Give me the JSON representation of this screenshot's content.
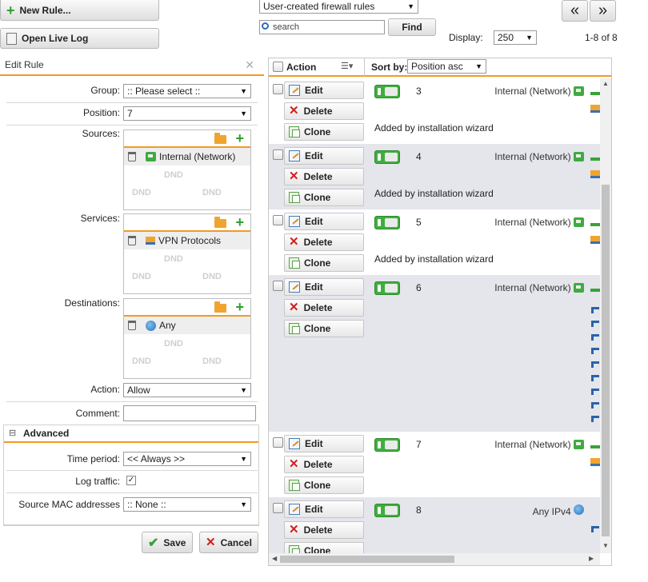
{
  "toolbar": {
    "new_rule": "New Rule...",
    "open_live_log": "Open Live Log",
    "filter_select": "User-created firewall rules",
    "search_placeholder": "search",
    "find": "Find",
    "display_label": "Display:",
    "display_value": "250",
    "range": "1-8 of 8",
    "prev": "«",
    "next": "»"
  },
  "edit_rule": {
    "title": "Edit Rule",
    "group_label": "Group:",
    "group_value": ":: Please select ::",
    "position_label": "Position:",
    "position_value": "7",
    "sources_label": "Sources:",
    "sources_item": "Internal (Network)",
    "services_label": "Services:",
    "services_item": "VPN Protocols",
    "destinations_label": "Destinations:",
    "destinations_item": "Any",
    "dnd": "DND",
    "action_label": "Action:",
    "action_value": "Allow",
    "comment_label": "Comment:",
    "advanced": "Advanced",
    "advanced_toggle": "⊟",
    "time_period_label": "Time period:",
    "time_period_value": "<< Always >>",
    "log_traffic_label": "Log traffic:",
    "source_mac_label": "Source MAC addresses",
    "source_mac_value": ":: None ::",
    "save": "Save",
    "cancel": "Cancel",
    "close": "✕"
  },
  "table": {
    "col_action": "Action",
    "sort_by_label": "Sort by:",
    "sort_value": "Position asc",
    "edit": "Edit",
    "delete": "Delete",
    "clone": "Clone",
    "rows": [
      {
        "position": "3",
        "source": "Internal (Network)",
        "comment": "Added by installation wizard"
      },
      {
        "position": "4",
        "source": "Internal (Network)",
        "comment": "Added by installation wizard"
      },
      {
        "position": "5",
        "source": "Internal (Network)",
        "comment": "Added by installation wizard"
      },
      {
        "position": "6",
        "source": "Internal (Network)",
        "comment": ""
      },
      {
        "position": "7",
        "source": "Internal (Network)",
        "comment": ""
      },
      {
        "position": "8",
        "source": "Any IPv4",
        "comment": ""
      }
    ]
  },
  "colors": {
    "accent_orange": "#f39a22",
    "toggle_green": "#3fae3f",
    "row_alt": "#e5e5ec"
  }
}
